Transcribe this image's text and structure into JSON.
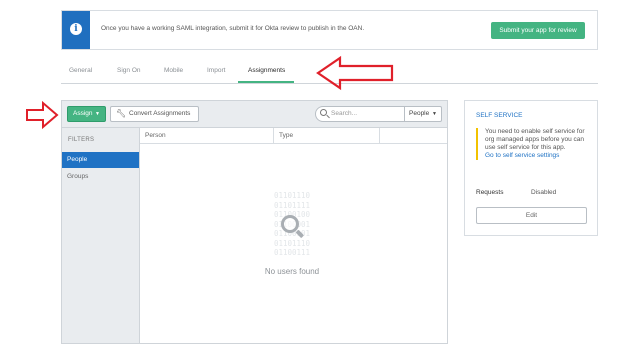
{
  "banner": {
    "text": "Once you have a working SAML integration, submit it for Okta review to publish in the OAN.",
    "button_label": "Submit your app for review"
  },
  "tabs": [
    {
      "label": "General"
    },
    {
      "label": "Sign On"
    },
    {
      "label": "Mobile"
    },
    {
      "label": "Import"
    },
    {
      "label": "Assignments",
      "active": true
    }
  ],
  "toolbar": {
    "assign_label": "Assign",
    "convert_label": "Convert Assignments",
    "search_placeholder": "Search...",
    "people_select_value": "People"
  },
  "filters": {
    "heading": "FILTERS",
    "items": [
      {
        "label": "People",
        "active": true
      },
      {
        "label": "Groups"
      }
    ]
  },
  "table": {
    "columns": [
      "Person",
      "Type"
    ],
    "empty_binary": [
      "01101110",
      "01101111",
      "01100100",
      "01100001",
      "01100101",
      "01101110",
      "01100111"
    ],
    "empty_text": "No users found"
  },
  "self_service": {
    "title": "SELF SERVICE",
    "note": "You need to enable self service for org managed apps before you can use self service for this app.",
    "link": "Go to self service settings",
    "requests_label": "Requests",
    "requests_value": "Disabled",
    "edit_label": "Edit"
  },
  "colors": {
    "accent_green": "#44b482",
    "accent_blue": "#1f72c4",
    "annotation_red": "#e0202a",
    "warning_yellow": "#f2c200"
  }
}
